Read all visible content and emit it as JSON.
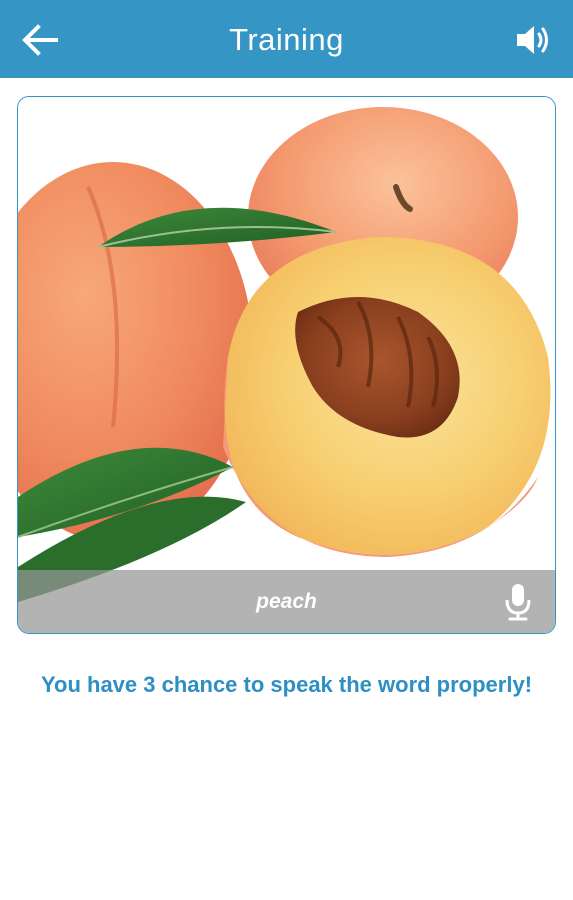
{
  "app_bar": {
    "title": "Training",
    "back_icon": "arrow-left-icon",
    "sound_icon": "speaker-icon",
    "background_color": "#3596c6"
  },
  "card": {
    "image": "peach",
    "word": "peach",
    "mic_icon": "microphone-icon"
  },
  "message": "You have 3 chance to speak the word properly!",
  "colors": {
    "accent": "#3596c6",
    "message_text": "#2d8fc2"
  }
}
